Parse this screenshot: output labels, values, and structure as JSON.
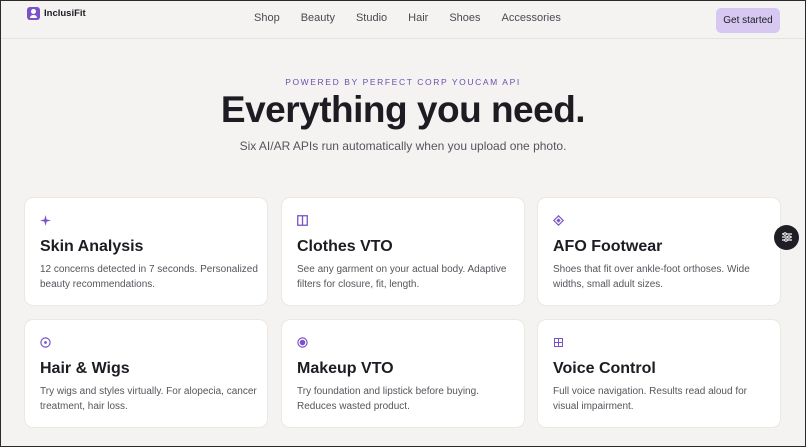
{
  "header": {
    "brand": "InclusiFit",
    "nav": [
      "Shop",
      "Beauty",
      "Studio",
      "Hair",
      "Shoes",
      "Accessories"
    ],
    "cta_label": "Get started"
  },
  "hero": {
    "eyebrow": "POWERED BY PERFECT CORP YOUCAM API",
    "title": "Everything you need.",
    "subtitle": "Six AI/AR APIs run automatically when you upload one photo."
  },
  "features": [
    {
      "icon": "sparkle-icon",
      "title": "Skin Analysis",
      "desc": "12 concerns detected in 7 seconds. Personalized beauty recommendations."
    },
    {
      "icon": "panel-icon",
      "title": "Clothes VTO",
      "desc": "See any garment on your actual body. Adaptive filters for closure, fit, length."
    },
    {
      "icon": "diamond-icon",
      "title": "AFO Footwear",
      "desc": "Shoes that fit over ankle-foot orthoses. Wide widths, small adult sizes."
    },
    {
      "icon": "circle-dot-icon",
      "title": "Hair & Wigs",
      "desc": "Try wigs and styles virtually. For alopecia, cancer treatment, hair loss."
    },
    {
      "icon": "filled-circle-icon",
      "title": "Makeup VTO",
      "desc": "Try foundation and lipstick before buying. Reduces wasted product."
    },
    {
      "icon": "grid-icon",
      "title": "Voice Control",
      "desc": "Full voice navigation. Results read aloud for visual impairment."
    }
  ],
  "colors": {
    "accent": "#7a53c8",
    "background": "#f5f3f1",
    "cta_bg": "#d7c8f2"
  }
}
